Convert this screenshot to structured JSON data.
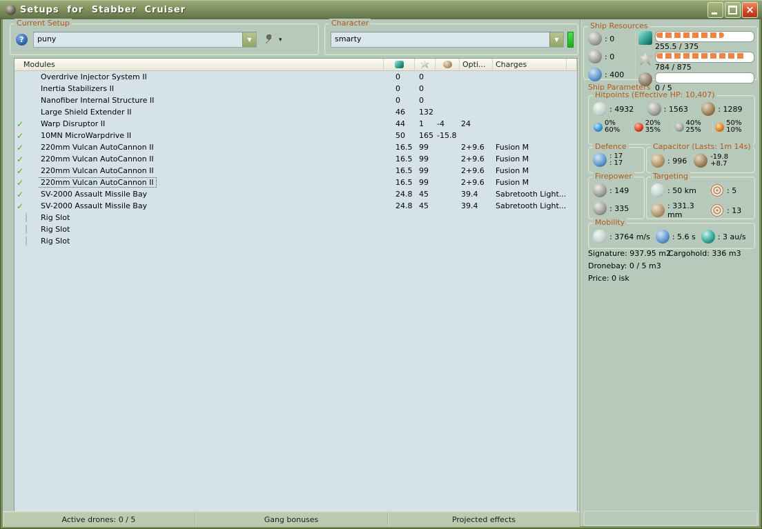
{
  "window": {
    "title": "Setups for Stabber Cruiser"
  },
  "setup": {
    "label": "Current Setup",
    "value": "puny"
  },
  "character": {
    "label": "Character",
    "value": "smarty"
  },
  "ship_resources": {
    "label": "Ship Resources",
    "turrets": ": 0",
    "launchers": ": 0",
    "calibration": ": 400",
    "cpu": {
      "text": "255.5 / 375",
      "pct": 70
    },
    "powergrid": {
      "text": "784 / 875",
      "pct": 93
    },
    "drones": {
      "text": "0 / 5",
      "pct": 0
    }
  },
  "modules": {
    "title": "Modules",
    "columns": {
      "opti": "Opti...",
      "charges": "Charges"
    },
    "rows": [
      {
        "active": false,
        "icon": "overdrive",
        "name": "Overdrive Injector System II",
        "cpu": "0",
        "pg": "0",
        "cap": "",
        "opti": "",
        "charges": "",
        "selected": false
      },
      {
        "active": false,
        "icon": "inertia",
        "name": "Inertia Stabilizers II",
        "cpu": "0",
        "pg": "0",
        "cap": "",
        "opti": "",
        "charges": "",
        "selected": false
      },
      {
        "active": false,
        "icon": "nanofiber",
        "name": "Nanofiber Internal Structure II",
        "cpu": "0",
        "pg": "0",
        "cap": "",
        "opti": "",
        "charges": "",
        "selected": false
      },
      {
        "active": false,
        "icon": "shield-extender",
        "name": "Large Shield Extender II",
        "cpu": "46",
        "pg": "132",
        "cap": "",
        "opti": "",
        "charges": "",
        "selected": false
      },
      {
        "active": true,
        "icon": "warp-disruptor",
        "name": "Warp Disruptor II",
        "cpu": "44",
        "pg": "1",
        "cap": "-4",
        "opti": "24",
        "charges": "",
        "selected": false
      },
      {
        "active": true,
        "icon": "mwd",
        "name": "10MN MicroWarpdrive II",
        "cpu": "50",
        "pg": "165",
        "cap": "-15.8",
        "opti": "",
        "charges": "",
        "selected": false
      },
      {
        "active": true,
        "icon": "autocannon",
        "name": "220mm Vulcan AutoCannon II",
        "cpu": "16.5",
        "pg": "99",
        "cap": "",
        "opti": "2+9.6",
        "charges": "Fusion M",
        "selected": false
      },
      {
        "active": true,
        "icon": "autocannon",
        "name": "220mm Vulcan AutoCannon II",
        "cpu": "16.5",
        "pg": "99",
        "cap": "",
        "opti": "2+9.6",
        "charges": "Fusion M",
        "selected": false
      },
      {
        "active": true,
        "icon": "autocannon",
        "name": "220mm Vulcan AutoCannon II",
        "cpu": "16.5",
        "pg": "99",
        "cap": "",
        "opti": "2+9.6",
        "charges": "Fusion M",
        "selected": false
      },
      {
        "active": true,
        "icon": "autocannon",
        "name": "220mm Vulcan AutoCannon II",
        "cpu": "16.5",
        "pg": "99",
        "cap": "",
        "opti": "2+9.6",
        "charges": "Fusion M",
        "selected": true
      },
      {
        "active": true,
        "icon": "missile-bay",
        "name": "SV-2000 Assault Missile Bay",
        "cpu": "24.8",
        "pg": "45",
        "cap": "",
        "opti": "39.4",
        "charges": "Sabretooth Light...",
        "selected": false
      },
      {
        "active": true,
        "icon": "missile-bay",
        "name": "SV-2000 Assault Missile Bay",
        "cpu": "24.8",
        "pg": "45",
        "cap": "",
        "opti": "39.4",
        "charges": "Sabretooth Light...",
        "selected": false
      },
      {
        "active": false,
        "icon": "rig-slot",
        "name": "Rig Slot",
        "cpu": "",
        "pg": "",
        "cap": "",
        "opti": "",
        "charges": "",
        "selected": false
      },
      {
        "active": false,
        "icon": "rig-slot",
        "name": "Rig Slot",
        "cpu": "",
        "pg": "",
        "cap": "",
        "opti": "",
        "charges": "",
        "selected": false
      },
      {
        "active": false,
        "icon": "rig-slot",
        "name": "Rig Slot",
        "cpu": "",
        "pg": "",
        "cap": "",
        "opti": "",
        "charges": "",
        "selected": false
      }
    ]
  },
  "ship_parameters": {
    "label": "Ship Parameters",
    "hitpoints": {
      "label": "Hitpoints (Effective HP: 10,407)",
      "shield": ": 4932",
      "armor": ": 1563",
      "hull": ": 1289",
      "resists": [
        {
          "type": "em",
          "v1": "0%",
          "v2": "60%"
        },
        {
          "type": "thermal",
          "v1": "20%",
          "v2": "35%"
        },
        {
          "type": "kinetic",
          "v1": "40%",
          "v2": "25%"
        },
        {
          "type": "explosive",
          "v1": "50%",
          "v2": "10%"
        }
      ]
    },
    "defence": {
      "label": "Defence",
      "v1": ": 17",
      "v2": ": 17"
    },
    "capacitor": {
      "label": "Capacitor (Lasts: 1m 14s)",
      "amount": ": 996",
      "delta1": "-19.8",
      "delta2": "+8.7"
    },
    "firepower": {
      "label": "Firepower",
      "turret": ": 149",
      "missile": ": 335"
    },
    "targeting": {
      "label": "Targeting",
      "range": ": 50 km",
      "max_targets": ": 5",
      "scan_res": ": 331.3 mm",
      "sensor_strength": ": 13"
    },
    "mobility": {
      "label": "Mobility",
      "speed": ": 3764 m/s",
      "align": ": 5.6 s",
      "warp": ": 3 au/s"
    },
    "signature": "Signature: 937.95 m2",
    "cargohold": "Cargohold: 336 m3",
    "dronebay": "Dronebay: 0 / 5 m3",
    "price": "Price: 0 isk"
  },
  "footer": {
    "active_drones": "Active drones: 0 / 5",
    "gang_bonuses": "Gang bonuses",
    "projected_effects": "Projected effects"
  }
}
